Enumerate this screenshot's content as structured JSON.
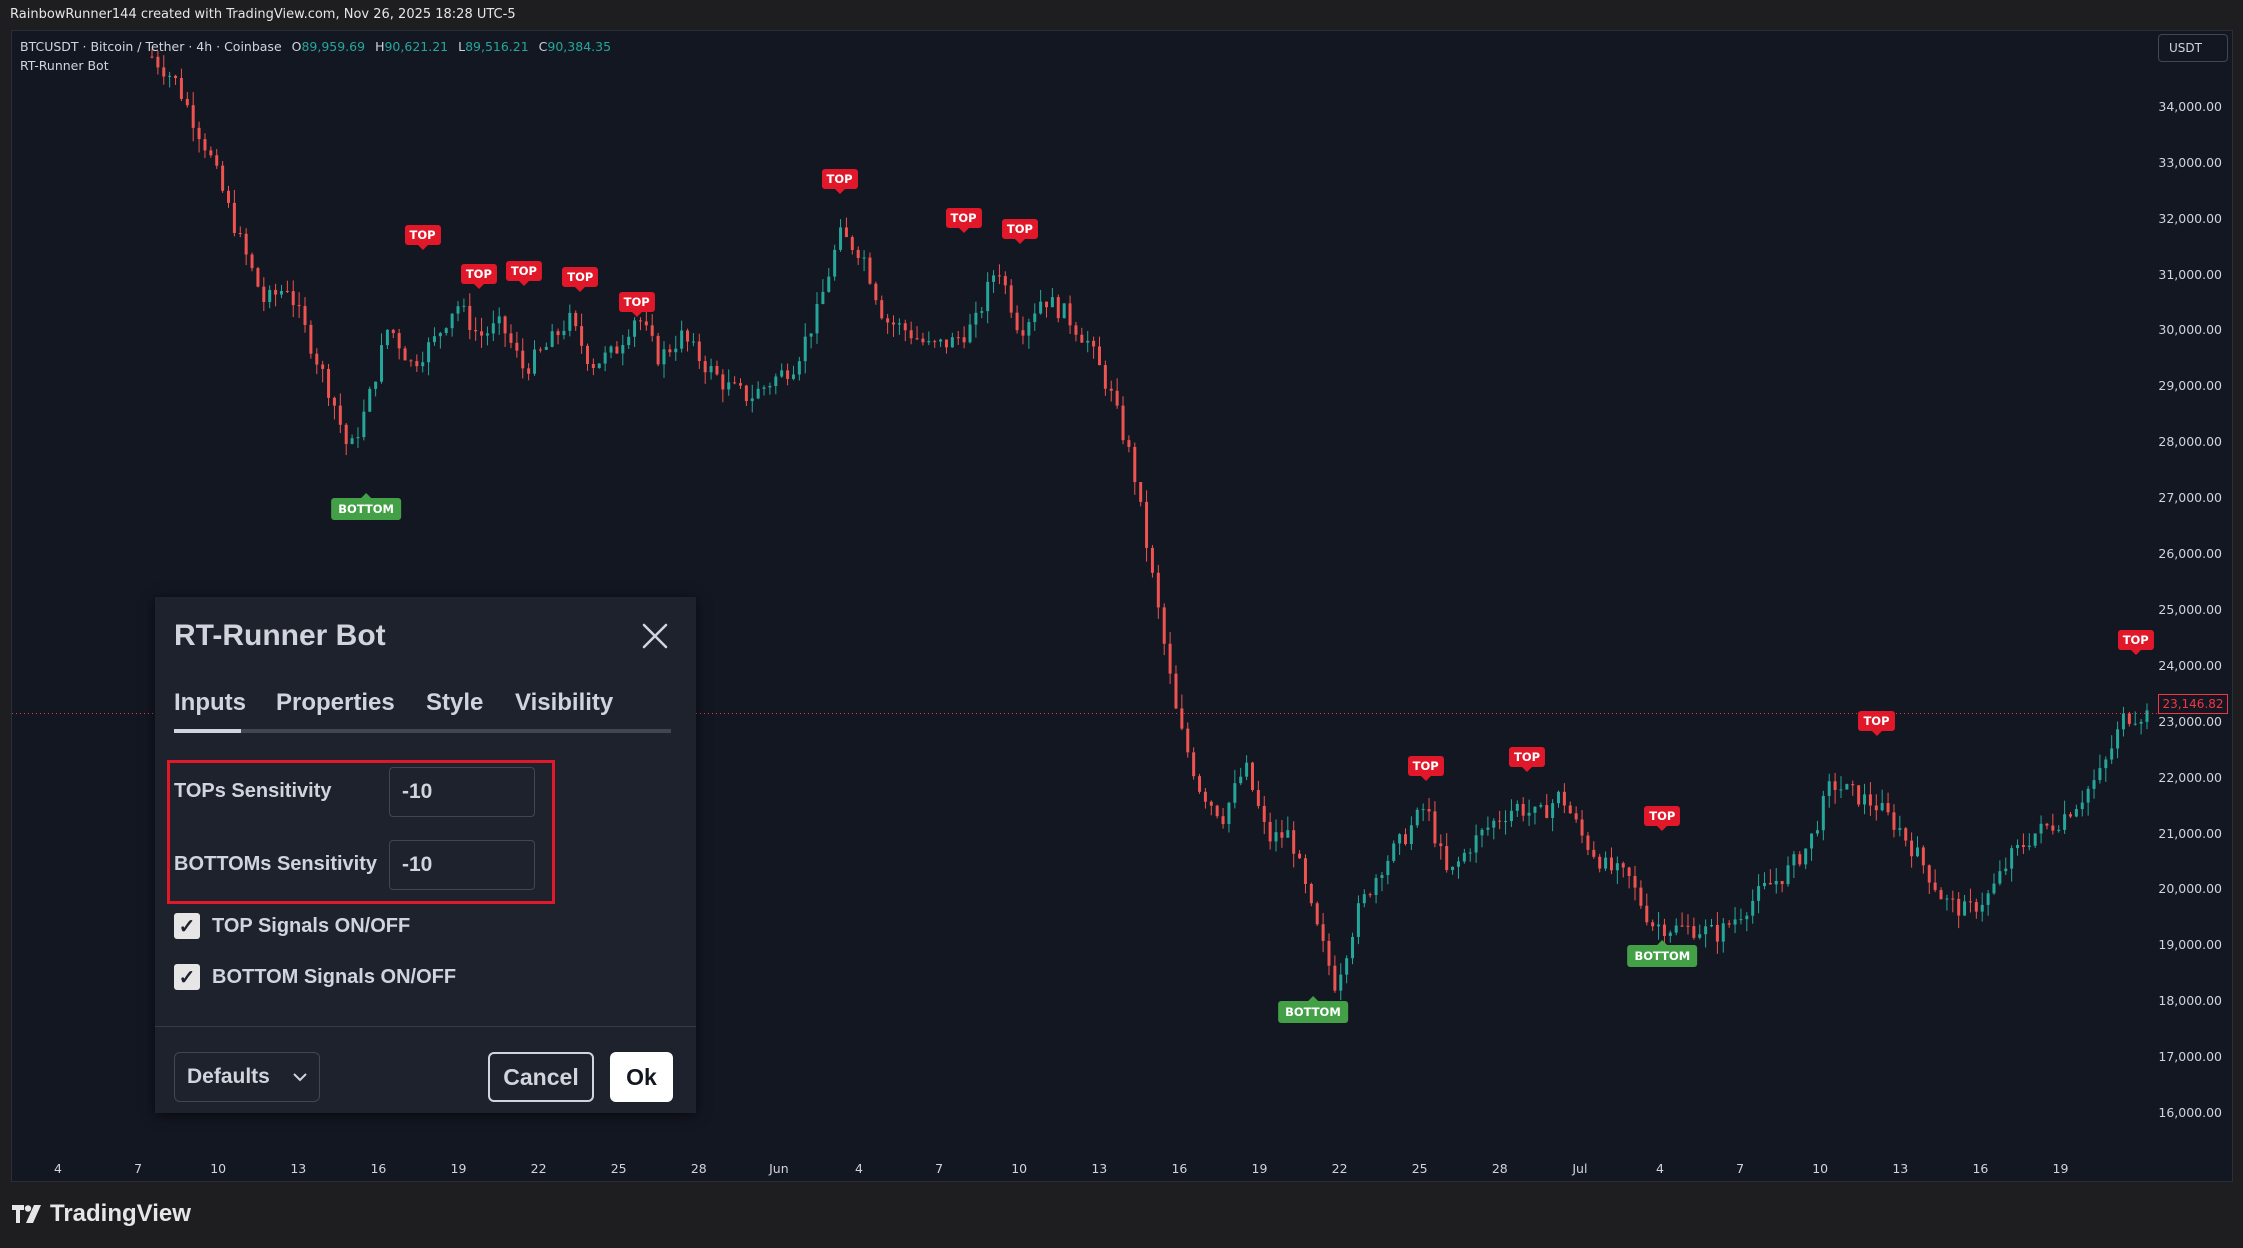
{
  "attribution": "RainbowRunner144 created with TradingView.com, Nov 26, 2025 18:28 UTC-5",
  "symbol": {
    "title": "BTCUSDT · Bitcoin / Tether · 4h · Coinbase",
    "open_key": "O",
    "open": "89,959.69",
    "high_key": "H",
    "high": "90,621.21",
    "low_key": "L",
    "low": "89,516.21",
    "close_key": "C",
    "close": "90,384.35"
  },
  "indicator_name": "RT-Runner Bot",
  "currency": "USDT",
  "last_price": "23,146.82",
  "colors": {
    "up": "#26a69a",
    "down": "#ef5350",
    "top_signal": "#e0182a",
    "bottom_signal": "#43a047"
  },
  "y_axis": [
    "34,000.00",
    "33,000.00",
    "32,000.00",
    "31,000.00",
    "30,000.00",
    "29,000.00",
    "28,000.00",
    "27,000.00",
    "26,000.00",
    "25,000.00",
    "24,000.00",
    "23,000.00",
    "22,000.00",
    "21,000.00",
    "20,000.00",
    "19,000.00",
    "18,000.00",
    "17,000.00",
    "16,000.00"
  ],
  "x_axis": [
    "4",
    "7",
    "10",
    "13",
    "16",
    "19",
    "22",
    "25",
    "28",
    "Jun",
    "4",
    "7",
    "10",
    "13",
    "16",
    "19",
    "22",
    "25",
    "28",
    "Jul",
    "4",
    "7",
    "10",
    "13",
    "16",
    "19"
  ],
  "signals": {
    "top_label": "TOP",
    "bottom_label": "BOTTOM"
  },
  "chart_data": {
    "type": "candlestick",
    "ylim": [
      15500,
      35000
    ],
    "y_ticks": [
      16000,
      17000,
      18000,
      19000,
      20000,
      21000,
      22000,
      23000,
      24000,
      25000,
      26000,
      27000,
      28000,
      29000,
      30000,
      31000,
      32000,
      33000,
      34000
    ],
    "x_ticks": [
      "4",
      "7",
      "10",
      "13",
      "16",
      "19",
      "22",
      "25",
      "28",
      "Jun",
      "4",
      "7",
      "10",
      "13",
      "16",
      "19",
      "22",
      "25",
      "28",
      "Jul",
      "4",
      "7",
      "10",
      "13",
      "16",
      "19"
    ],
    "approx_close_path": [
      [
        0,
        34900
      ],
      [
        2,
        34500
      ],
      [
        5,
        33200
      ],
      [
        8,
        31500
      ],
      [
        10,
        30500
      ],
      [
        12,
        30800
      ],
      [
        14,
        29800
      ],
      [
        16,
        28800
      ],
      [
        17.5,
        27800
      ],
      [
        19,
        28600
      ],
      [
        21,
        30100
      ],
      [
        23,
        29400
      ],
      [
        25,
        29800
      ],
      [
        27,
        30500
      ],
      [
        29,
        29900
      ],
      [
        31,
        30100
      ],
      [
        33,
        29300
      ],
      [
        35,
        29700
      ],
      [
        37,
        30200
      ],
      [
        39,
        29400
      ],
      [
        41,
        29600
      ],
      [
        43,
        30300
      ],
      [
        45,
        29500
      ],
      [
        47,
        29900
      ],
      [
        49,
        29400
      ],
      [
        51,
        29000
      ],
      [
        53,
        28800
      ],
      [
        55,
        29100
      ],
      [
        57,
        29400
      ],
      [
        59,
        30300
      ],
      [
        61,
        31700
      ],
      [
        63,
        31400
      ],
      [
        65,
        30200
      ],
      [
        67,
        30000
      ],
      [
        69,
        29700
      ],
      [
        71,
        29800
      ],
      [
        73,
        30100
      ],
      [
        75,
        31200
      ],
      [
        77,
        30000
      ],
      [
        79,
        30600
      ],
      [
        81,
        30300
      ],
      [
        83,
        29800
      ],
      [
        85,
        28900
      ],
      [
        87,
        27600
      ],
      [
        89,
        25300
      ],
      [
        91,
        23000
      ],
      [
        93,
        21800
      ],
      [
        95,
        21300
      ],
      [
        97,
        22200
      ],
      [
        99,
        20900
      ],
      [
        101,
        21000
      ],
      [
        103,
        19500
      ],
      [
        105,
        18300
      ],
      [
        107,
        19600
      ],
      [
        109,
        20400
      ],
      [
        111,
        20900
      ],
      [
        113,
        21500
      ],
      [
        115,
        20200
      ],
      [
        117,
        20800
      ],
      [
        119,
        21200
      ],
      [
        121,
        21500
      ],
      [
        123,
        21300
      ],
      [
        125,
        21700
      ],
      [
        127,
        20900
      ],
      [
        129,
        20400
      ],
      [
        131,
        20200
      ],
      [
        133,
        19400
      ],
      [
        135,
        19300
      ],
      [
        137,
        19300
      ],
      [
        139,
        19200
      ],
      [
        141,
        19600
      ],
      [
        143,
        20000
      ],
      [
        145,
        20300
      ],
      [
        147,
        20800
      ],
      [
        149,
        21900
      ],
      [
        151,
        21700
      ],
      [
        153,
        21500
      ],
      [
        155,
        21100
      ],
      [
        157,
        20500
      ],
      [
        159,
        19800
      ],
      [
        161,
        19600
      ],
      [
        163,
        19900
      ],
      [
        165,
        20600
      ],
      [
        167,
        21000
      ],
      [
        169,
        21200
      ],
      [
        171,
        21600
      ],
      [
        173,
        22100
      ],
      [
        175,
        23100
      ],
      [
        177,
        23146.82
      ]
    ],
    "signals": [
      {
        "type": "TOP",
        "price": 31500,
        "i": 24
      },
      {
        "type": "TOP",
        "price": 30800,
        "i": 29
      },
      {
        "type": "TOP",
        "price": 30850,
        "i": 33
      },
      {
        "type": "TOP",
        "price": 30750,
        "i": 38
      },
      {
        "type": "TOP",
        "price": 30300,
        "i": 43
      },
      {
        "type": "TOP",
        "price": 32500,
        "i": 61
      },
      {
        "type": "TOP",
        "price": 31800,
        "i": 72
      },
      {
        "type": "TOP",
        "price": 31600,
        "i": 77
      },
      {
        "type": "BOTTOM",
        "price": 27000,
        "i": 19
      },
      {
        "type": "TOP",
        "price": 22000,
        "i": 113
      },
      {
        "type": "TOP",
        "price": 22150,
        "i": 122
      },
      {
        "type": "TOP",
        "price": 21100,
        "i": 134
      },
      {
        "type": "BOTTOM",
        "price": 18000,
        "i": 103
      },
      {
        "type": "BOTTOM",
        "price": 19000,
        "i": 134
      },
      {
        "type": "TOP",
        "price": 22800,
        "i": 153
      },
      {
        "type": "TOP",
        "price": 24250,
        "i": 176
      }
    ]
  },
  "dialog": {
    "title": "RT-Runner Bot",
    "tabs": [
      "Inputs",
      "Properties",
      "Style",
      "Visibility"
    ],
    "tops_label": "TOPs Sensitivity",
    "tops_value": "-10",
    "bottoms_label": "BOTTOMs Sensitivity",
    "bottoms_value": "-10",
    "top_signals_label": "TOP Signals ON/OFF",
    "top_signals_checked": true,
    "bottom_signals_label": "BOTTOM Signals ON/OFF",
    "bottom_signals_checked": true,
    "defaults_label": "Defaults",
    "cancel_label": "Cancel",
    "ok_label": "Ok"
  },
  "brand": "TradingView"
}
